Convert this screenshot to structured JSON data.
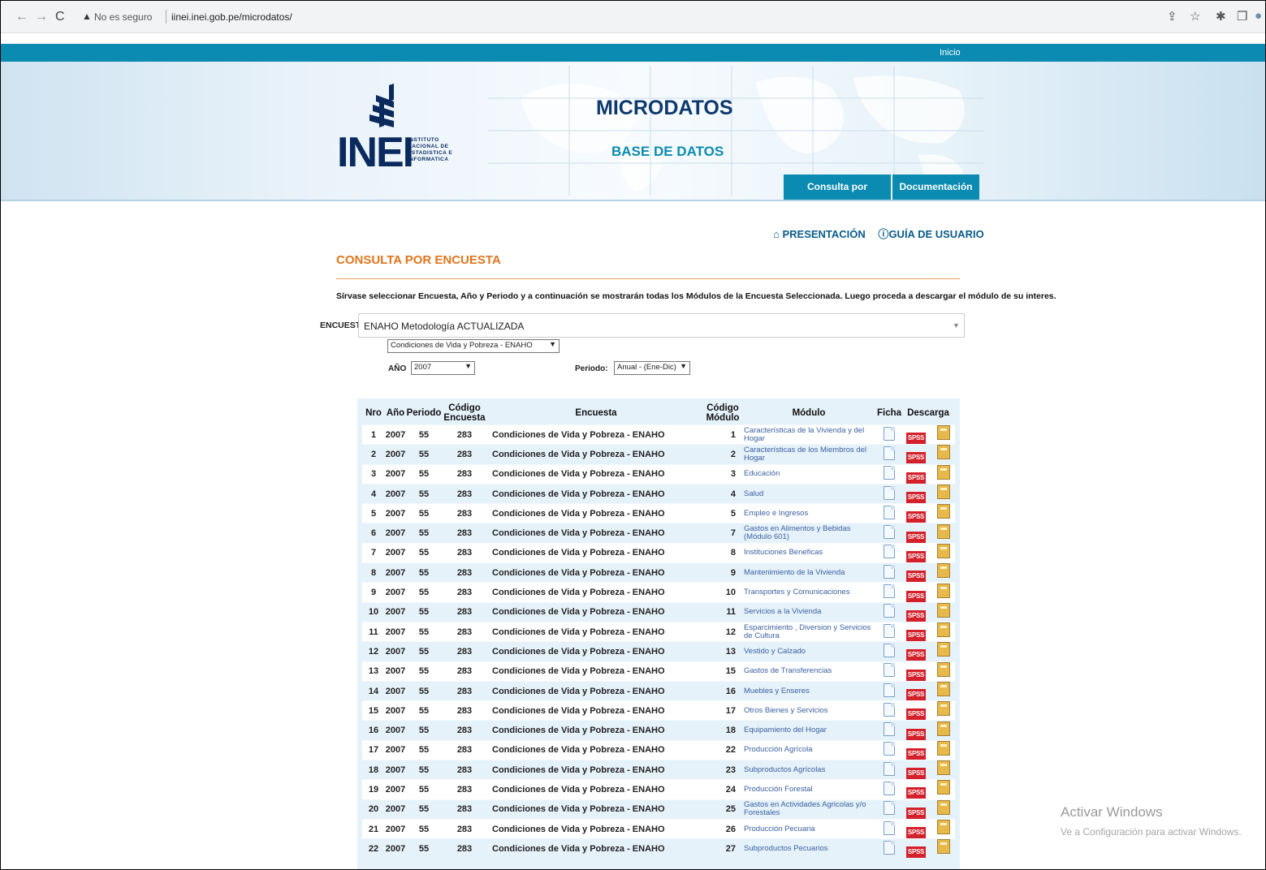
{
  "browser": {
    "back_icon": "←",
    "forward_icon": "→",
    "reload_icon": "C",
    "warning_icon": "▲",
    "insecure_label": "No es seguro",
    "url": "iinei.inei.gob.pe/microdatos/",
    "toolbar_icons": [
      "⇪",
      "☆",
      "✱",
      "❒",
      "●"
    ]
  },
  "header": {
    "top_link": "Inicio",
    "logo_text": "INEI",
    "logo_subtitle": [
      "INSTITUTO",
      "NACIONAL DE",
      "ESTADISTICA E",
      "INFORMATICA"
    ],
    "title": "MICRODATOS",
    "subtitle": "BASE DE DATOS",
    "tabs": [
      "Consulta por Encuestas",
      "Documentación"
    ]
  },
  "links": {
    "presentacion": "PRESENTACIÓN",
    "guia": "GUÍA DE USUARIO"
  },
  "section_title": "CONSULTA POR ENCUESTA",
  "instructions": "Sírvase seleccionar Encuesta, Año y Periodo y a continuación se mostrarán todas los Módulos de la Encuesta Seleccionada. Luego proceda a descargar el módulo de su interes.",
  "form": {
    "encuesta_label": "ENCUESTA",
    "encuesta_value": "ENAHO Metodología ACTUALIZADA",
    "sub_value": "Condiciones de Vida y Pobreza - ENAHO",
    "anio_label": "AÑO",
    "anio_value": "2007",
    "periodo_label": "Periodo:",
    "periodo_value": "Anual - (Ene-Dic)"
  },
  "table": {
    "headers": [
      "Nro",
      "Año",
      "Periodo",
      "Código Encuesta",
      "Encuesta",
      "Código Módulo",
      "Módulo",
      "Ficha",
      "Descarga"
    ],
    "spss_label": "SPSS",
    "rows": [
      {
        "nro": "1",
        "anio": "2007",
        "periodo": "55",
        "cod_enc": "283",
        "encuesta": "Condiciones de Vida y Pobreza - ENAHO",
        "cod_mod": "1",
        "modulo": "Características de la Vivienda y del Hogar"
      },
      {
        "nro": "2",
        "anio": "2007",
        "periodo": "55",
        "cod_enc": "283",
        "encuesta": "Condiciones de Vida y Pobreza - ENAHO",
        "cod_mod": "2",
        "modulo": "Características de los Miembros del Hogar"
      },
      {
        "nro": "3",
        "anio": "2007",
        "periodo": "55",
        "cod_enc": "283",
        "encuesta": "Condiciones de Vida y Pobreza - ENAHO",
        "cod_mod": "3",
        "modulo": "Educación"
      },
      {
        "nro": "4",
        "anio": "2007",
        "periodo": "55",
        "cod_enc": "283",
        "encuesta": "Condiciones de Vida y Pobreza - ENAHO",
        "cod_mod": "4",
        "modulo": "Salud"
      },
      {
        "nro": "5",
        "anio": "2007",
        "periodo": "55",
        "cod_enc": "283",
        "encuesta": "Condiciones de Vida y Pobreza - ENAHO",
        "cod_mod": "5",
        "modulo": "Empleo e Ingresos"
      },
      {
        "nro": "6",
        "anio": "2007",
        "periodo": "55",
        "cod_enc": "283",
        "encuesta": "Condiciones de Vida y Pobreza - ENAHO",
        "cod_mod": "7",
        "modulo": "Gastos en Alimentos y Bebidas (Módulo 601)"
      },
      {
        "nro": "7",
        "anio": "2007",
        "periodo": "55",
        "cod_enc": "283",
        "encuesta": "Condiciones de Vida y Pobreza - ENAHO",
        "cod_mod": "8",
        "modulo": "Instituciones Beneficas"
      },
      {
        "nro": "8",
        "anio": "2007",
        "periodo": "55",
        "cod_enc": "283",
        "encuesta": "Condiciones de Vida y Pobreza - ENAHO",
        "cod_mod": "9",
        "modulo": "Mantenimiento de la Vivienda"
      },
      {
        "nro": "9",
        "anio": "2007",
        "periodo": "55",
        "cod_enc": "283",
        "encuesta": "Condiciones de Vida y Pobreza - ENAHO",
        "cod_mod": "10",
        "modulo": "Transportes y Comunicaciones"
      },
      {
        "nro": "10",
        "anio": "2007",
        "periodo": "55",
        "cod_enc": "283",
        "encuesta": "Condiciones de Vida y Pobreza - ENAHO",
        "cod_mod": "11",
        "modulo": "Servicios a la Vivienda"
      },
      {
        "nro": "11",
        "anio": "2007",
        "periodo": "55",
        "cod_enc": "283",
        "encuesta": "Condiciones de Vida y Pobreza - ENAHO",
        "cod_mod": "12",
        "modulo": "Esparcimiento , Diversion y Servicios de Cultura"
      },
      {
        "nro": "12",
        "anio": "2007",
        "periodo": "55",
        "cod_enc": "283",
        "encuesta": "Condiciones de Vida y Pobreza - ENAHO",
        "cod_mod": "13",
        "modulo": "Vestido y Calzado"
      },
      {
        "nro": "13",
        "anio": "2007",
        "periodo": "55",
        "cod_enc": "283",
        "encuesta": "Condiciones de Vida y Pobreza - ENAHO",
        "cod_mod": "15",
        "modulo": "Gastos de Transferencias"
      },
      {
        "nro": "14",
        "anio": "2007",
        "periodo": "55",
        "cod_enc": "283",
        "encuesta": "Condiciones de Vida y Pobreza - ENAHO",
        "cod_mod": "16",
        "modulo": "Muebles y Enseres"
      },
      {
        "nro": "15",
        "anio": "2007",
        "periodo": "55",
        "cod_enc": "283",
        "encuesta": "Condiciones de Vida y Pobreza - ENAHO",
        "cod_mod": "17",
        "modulo": "Otros Bienes y Servicios"
      },
      {
        "nro": "16",
        "anio": "2007",
        "periodo": "55",
        "cod_enc": "283",
        "encuesta": "Condiciones de Vida y Pobreza - ENAHO",
        "cod_mod": "18",
        "modulo": "Equipamiento del Hogar"
      },
      {
        "nro": "17",
        "anio": "2007",
        "periodo": "55",
        "cod_enc": "283",
        "encuesta": "Condiciones de Vida y Pobreza - ENAHO",
        "cod_mod": "22",
        "modulo": "Producción Agrícola"
      },
      {
        "nro": "18",
        "anio": "2007",
        "periodo": "55",
        "cod_enc": "283",
        "encuesta": "Condiciones de Vida y Pobreza - ENAHO",
        "cod_mod": "23",
        "modulo": "Subproductos Agrícolas"
      },
      {
        "nro": "19",
        "anio": "2007",
        "periodo": "55",
        "cod_enc": "283",
        "encuesta": "Condiciones de Vida y Pobreza - ENAHO",
        "cod_mod": "24",
        "modulo": "Producción Forestal"
      },
      {
        "nro": "20",
        "anio": "2007",
        "periodo": "55",
        "cod_enc": "283",
        "encuesta": "Condiciones de Vida y Pobreza - ENAHO",
        "cod_mod": "25",
        "modulo": "Gastos en Actividades Agricolas y/o Forestales"
      },
      {
        "nro": "21",
        "anio": "2007",
        "periodo": "55",
        "cod_enc": "283",
        "encuesta": "Condiciones de Vida y Pobreza - ENAHO",
        "cod_mod": "26",
        "modulo": "Producción Pecuaria"
      },
      {
        "nro": "22",
        "anio": "2007",
        "periodo": "55",
        "cod_enc": "283",
        "encuesta": "Condiciones de Vida y Pobreza - ENAHO",
        "cod_mod": "27",
        "modulo": "Subproductos Pecuarios"
      }
    ]
  },
  "windows_watermark": {
    "line1": "Activar Windows",
    "line2": "Ve a Configuración para activar Windows."
  },
  "colors": {
    "accent": "#0b8bb1",
    "section_title": "#e1751a",
    "spss": "#d4202a"
  }
}
